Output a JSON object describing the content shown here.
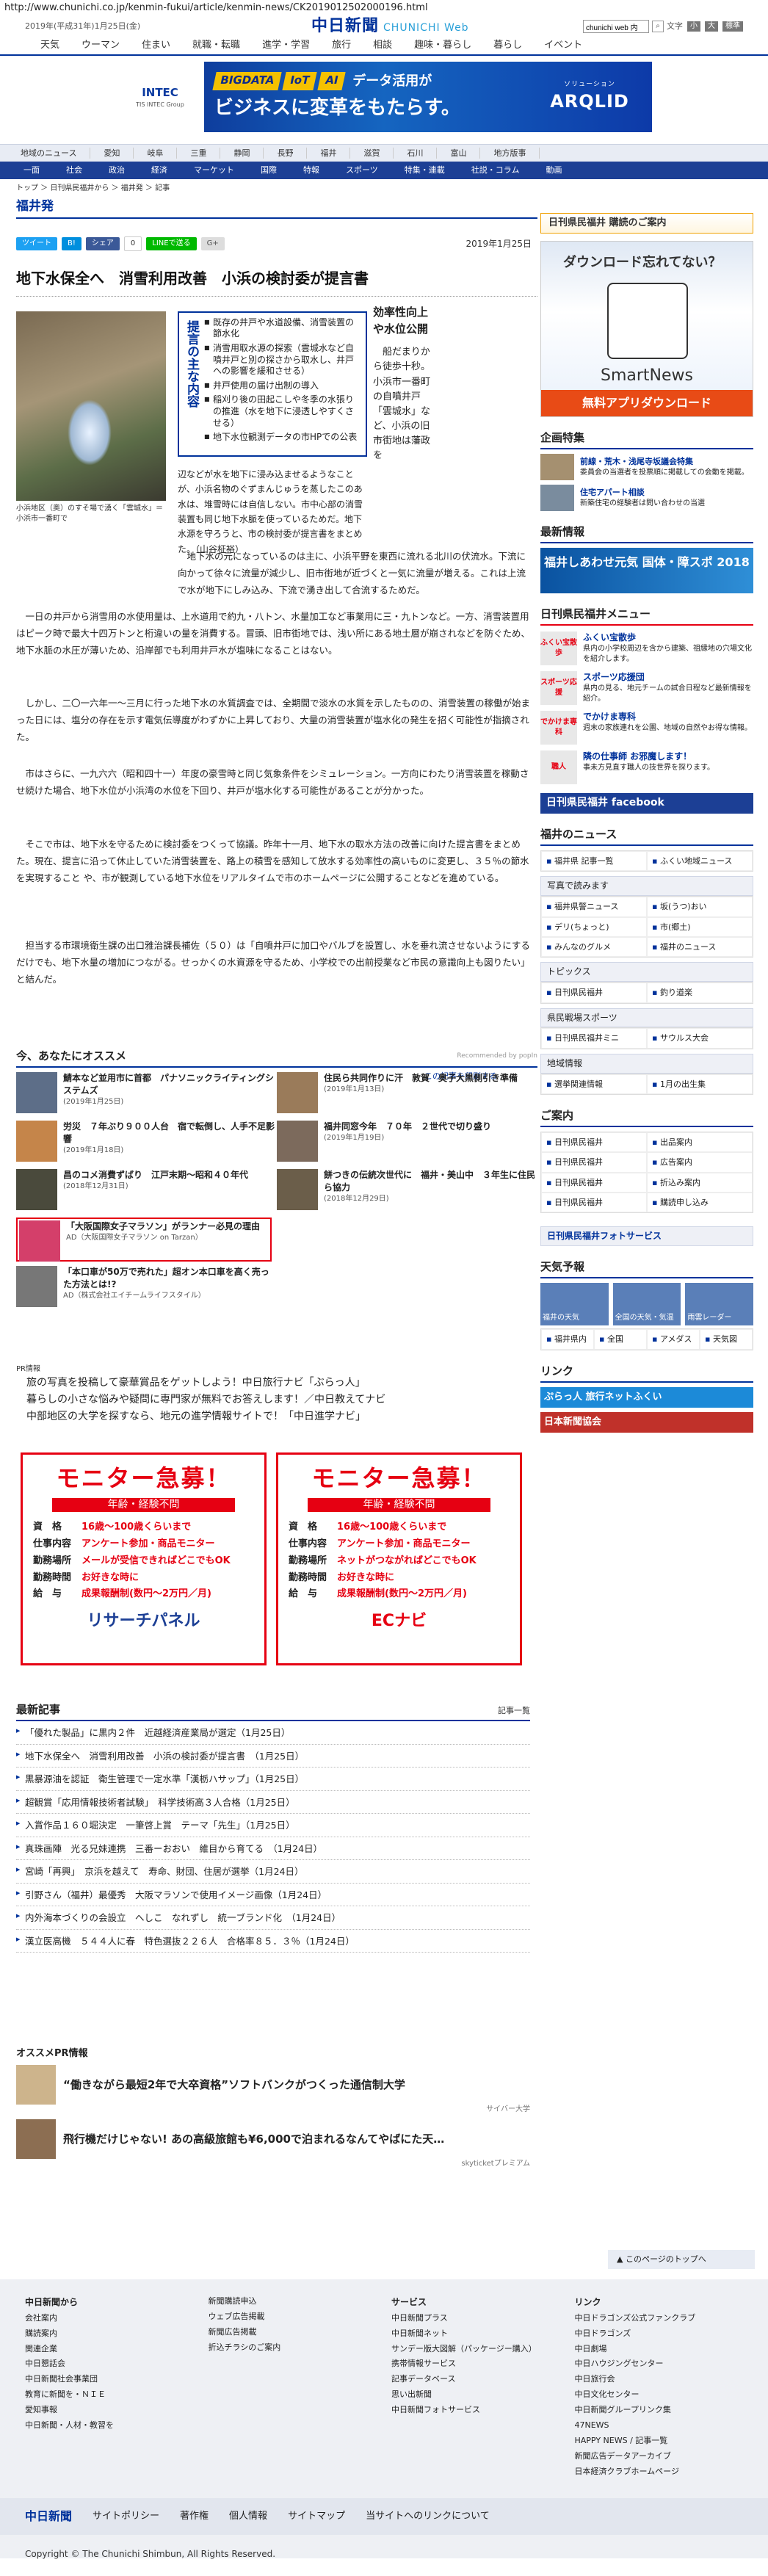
{
  "url": "http://www.chunichi.co.jp/kenmin-fukui/article/kenmin-news/CK2019012502000196.html",
  "top": {
    "date": "2019年(平成31年)1月25日(金)",
    "logo": "中日新聞",
    "logo_web": "CHUNICHI Web",
    "search_value": "chunichi web 内",
    "go": "文字",
    "font1": "小",
    "font2": "大",
    "font3": "標準"
  },
  "gnav": [
    "天気",
    "ウーマン",
    "住まい",
    "就職・転職",
    "進学・学習",
    "旅行",
    "相談",
    "趣味・暮らし",
    "暮らし",
    "イベント"
  ],
  "banner": {
    "brand": "INTEC",
    "brand_sub": "TIS INTEC Group",
    "tags": [
      "BIGDATA",
      "IoT",
      "AI"
    ],
    "tag_text": "データ活用が",
    "copy": "ビジネスに変革をもたらす。",
    "right": "ARQLID",
    "right_sub": "ソリューション"
  },
  "nav1": [
    "地域のニュース",
    "愛知",
    "岐阜",
    "三重",
    "静岡",
    "長野",
    "福井",
    "滋賀",
    "石川",
    "富山",
    "地方版事"
  ],
  "nav2": [
    "一面",
    "社会",
    "政治",
    "経済",
    "マーケット",
    "国際",
    "特報",
    "スポーツ",
    "特集・連載",
    "社説・コラム",
    "動画"
  ],
  "breadcrumb": "トップ ＞ 日刊県民福井から ＞ 福井発 ＞ 記事",
  "section": "福井発",
  "share": {
    "tweet": "ツイート",
    "hatena": "B!",
    "fb": "シェア",
    "fb_count": "0",
    "line": "LINEで送る",
    "gplus": "G+",
    "date": "2019年1月25日"
  },
  "headline": "地下水保全へ　消雪利用改善　小浜の検討委が提言書",
  "photo_caption": "小浜地区（奥）のすそ場で湧く「雲城水」＝小浜市一番町で",
  "kp": {
    "title": "提言の主な内容",
    "items": [
      "既存の井戸や水道設備、消雪装置の節水化",
      "消雪用取水源の探索（雲城水など自噴井戸と別の探さから取水し、井戸への影響を緩和させる）",
      "井戸使用の届け出制の導入",
      "稲刈り後の田起こしや冬季の水張りの推進（水を地下に浸透しやすくさせる）",
      "地下水位観測データの市HPでの公表"
    ]
  },
  "vcol": {
    "sub": "効率性向上や水位公開",
    "text": "　船だまりから徒歩十秒。小浜市一番町の自噴井戸「雲城水」など、小浜の旧市街地は藩政を"
  },
  "para_caption": "辺だけでなく地区全域を対象とした冬の小浜地区で毎年繰り返される地下水枯渇の問題を受け、市が設置した有識者らの検討委が提言書をまとめた。（山谷柾裕）",
  "kpcap": "辺などが水を地下に浸み込ませるようなことが、小浜名物のぐずまんじゅうを蒸したこのあ水は、堆雪時には自信しない。市中心部の消雪装置も同じ地下水脈を使っているためだ。地下水源を守ろうと、市の検討委が提言書をまとめた。（山谷柾裕）",
  "paras": [
    "　地下水の元になっているのは主に、小浜平野を東西に流れる北川の伏流水。下流に向かって徐々に流量が減少し、旧市街地が近づくと一気に流量が増える。これは上流で水が地下にしみ込み、下流で湧き出して合流するためだ。",
    "　一日の井戸から消雪用の水使用量は、上水道用で約九・八トン、水量加工など事業用に三・九トンなど。一方、消雪装置用はピーク時で最大十四万トンと桁違いの量を消費する。冒頭、旧市街地では、浅い所にある地土層が崩されなどを防ぐため、地下水脈の水圧が薄いため、沿岸部でも利用井戸水が塩味になることはない。",
    "　しかし、二〇一六年一〜三月に行った地下水の水質調査では、全期間で淡水の水質を示したものの、消雪装置の稼働が始まった日には、塩分の存在を示す電気伝導度がわずかに上昇しており、大量の消雪装置が塩水化の発生を招く可能性が指摘された。",
    "　市はさらに、一九六六（昭和四十一）年度の豪雪時と同じ気象条件をシミュレーション。一方向にわたり消雪装置を稼動させ続けた場合、地下水位が小浜湾の水位を下回り、井戸が塩水化する可能性があることが分かった。",
    "　そこで市は、地下水を守るために検討委をつくって協議。昨年十一月、地下水の取水方法の改善に向けた提言書をまとめた。現在、提言に沿って休止していた消雪装置を、路上の積雪を感知して放水する効率性の高いものに変更し、３５％の節水を実現すること や、市が観測している地下水位をリアルタイムで市のホームページに公開することなどを進めている。",
    "　担当する市環境衛生課の出口雅治課長補佐（５０）は「自噴井戸に加口やバルブを設置し、水を垂れ流させないようにするだけでも、地下水量の増加につながる。せっかくの水資源を守るため、小学校での出前授業など市民の意識向上も図りたい」と結んだ。"
  ],
  "reclink": "この記事を印刷する",
  "osusume": {
    "title": "今、あなたにオススメ",
    "powered": "Recommended by popIn",
    "cards": [
      {
        "t": "鯖本など並用市に首都　パナソニックライティングシステムズ",
        "d": "(2019年1月25日)"
      },
      {
        "t": "住民ら共同作りに汗　敦賀　奥子大黒側引き準備",
        "d": "(2019年1月13日)"
      },
      {
        "t": "労災　７年ぶり９００人台　宿で転倒し、人手不足影響",
        "d": "(2019年1月18日)"
      },
      {
        "t": "福井同窓今年　７０年　２世代で切り盛り",
        "d": "(2019年1月19日)"
      },
      {
        "t": "昌のコメ消費ずばり　江戸末期〜昭和４０年代",
        "d": "(2018年12月31日)"
      },
      {
        "t": "餅つきの伝統次世代に　福井・美山中　３年生に住民ら協力",
        "d": "(2018年12月29日)"
      },
      {
        "t": "「大阪国際女子マラソン」がランナー必見の理由",
        "d": "AD（大阪国際女子マラソン on Tarzan）"
      },
      {
        "t": "「本口車が50万で売れた」超オン本口車を高く売った方法とは!?",
        "d": "AD（株式会社エイチームライフスタイル）"
      }
    ]
  },
  "pr": {
    "title": "PR情報",
    "items": [
      "旅の写真を投稿して豪華賞品をゲットしよう！中日旅行ナビ「ぶらっ人」",
      "暮らしの小さな悩みや疑問に専門家が無料でお答えします！／中日教えてナビ",
      "中部地区の大学を探すなら、地元の進学情報サイトで！「中日進学ナビ」"
    ]
  },
  "monitor": [
    {
      "head": "モニター急募！",
      "band": "年齢・経験不問",
      "r1l": "資　格",
      "r1": "16歳〜100歳くらいまで",
      "r2l": "仕事内容",
      "r2": "アンケート参加・商品モニター",
      "r3l": "勤務場所",
      "r3": "メールが受信できればどこでもOK",
      "r4l": "勤務時間",
      "r4": "お好きな時に",
      "r5l": "給　与",
      "r5": "成果報酬制(数円〜2万円／月)",
      "logo": "リサーチパネル"
    },
    {
      "head": "モニター急募！",
      "band": "年齢・経験不問",
      "r1l": "資　格",
      "r1": "16歳〜100歳くらいまで",
      "r2l": "仕事内容",
      "r2": "アンケート参加・商品モニター",
      "r3l": "勤務場所",
      "r3": "ネットがつながればどこでもOK",
      "r4l": "勤務時間",
      "r4": "お好きな時に",
      "r5l": "給　与",
      "r5": "成果報酬制(数円〜2万円／月)",
      "logo": "ECナビ"
    }
  ],
  "latest": {
    "title": "最新記事",
    "more": "記事一覧",
    "items": [
      "「優れた製品」に黒内２件　近越経済産業局が選定（1月25日）",
      "地下水保全へ　消雪利用改善　小浜の検討委が提言書　（1月25日）",
      "黒暴源油を認証　衛生管理で一定水準「漢栃ハサップ」（1月25日）",
      "超観賞「応用情報技術者試験」　科学技術高３人合格（1月25日）",
      "入賞作品１６０堀決定　一筆啓上賞　テーマ「先生」（1月25日）",
      "真珠画陣　光る兄妹連携　三番ーおおい　維目から育てる　（1月24日）",
      "宮崎「再興」　京浜を越えて　寿命、財団、住居が選挙（1月24日）",
      "引野さん（福井）最優秀　大阪マラソンで使用イメージ画像（1月24日）",
      "内外海本づくりの会設立　へしこ　なれずし　統一ブランド化　（1月24日）",
      "漢立医高機　５４４人に春　特色選抜２２６人　合格率８５．３％（1月24日）"
    ]
  },
  "osupr": {
    "title": "オススメPR情報",
    "items": [
      "“働きながら最短2年で大卒資格”ソフトバンクがつくった通信制大学",
      "飛行機だけじゃない! あの高級旅館も¥6,000で泊まれるなんてやばにた天…"
    ],
    "by1": "サイバー大学",
    "by2": "skyticketプレミアム"
  },
  "side": {
    "kenmin_btn": "日刊県民福井 購読のご案内",
    "smartnews": {
      "title": "ダウンロード忘れてない？",
      "name": "SmartNews",
      "dl": "無料アプリダウンロード"
    },
    "kikaku": {
      "title": "企画特集",
      "items": [
        {
          "t": "前線・荒木・浅尾寺坂議会特集",
          "d": "委員会の当選者を投票順に掲載しての会動を掲載。"
        },
        {
          "t": "住宅アパート相談",
          "d": "新築住宅の経験者は問い合わせの当選"
        }
      ]
    },
    "saishin": "最新情報",
    "kokuta": "福井しあわせ元気 国体・障スポ 2018",
    "menu": {
      "title": "日刊県民福井メニュー",
      "items": [
        {
          "ic": "ふくい宝散歩",
          "t": "ふくい宝散歩",
          "d": "県内の小学校周辺を含から建築、祖縁地の穴場文化を紹介します。"
        },
        {
          "ic": "スポーツ応援",
          "t": "スポーツ応援団",
          "d": "県内の見る、地元チームの試合日程など最新情報を紹介。"
        },
        {
          "ic": "でかけま専科",
          "t": "でかけま専科",
          "d": "週末の家族連れを公園、地域の自然やお得な情報。"
        },
        {
          "ic": "職人",
          "t": "隣の仕事師 お邪魔します！",
          "d": "事未方見直す職人の技世界を探ります。"
        }
      ],
      "fb": "日刊県民福井 facebook"
    },
    "news": {
      "title": "福井のニュース",
      "tabs": [
        "福井県 記事一覧",
        "ふくい地域ニュース"
      ],
      "sub1": "写真で読みます",
      "items": [
        "福井県警ニュース",
        "坂(うつ)おい",
        "デリ(ちょっと)",
        "市(郷土)",
        "みんなのグルメ",
        "福井のニュース"
      ],
      "topics": "トピックス",
      "topics_items": [
        "日刊県民福井",
        "釣り道楽"
      ],
      "kenmin_sports": "県民戦場スポーツ",
      "ksp": [
        "日刊県民福井ミニ",
        "サウルス大会"
      ],
      "chiiki": "地域情報",
      "chiiki_items": [
        "選挙関連情報",
        "1月の出生集"
      ]
    },
    "annai": {
      "title": "ご案内",
      "items": [
        "日刊県民福井",
        "出品案内",
        "日刊県民福井",
        "広告案内",
        "日刊県民福井",
        "折込み案内",
        "日刊県民福井",
        "購読申し込み"
      ]
    },
    "photo": {
      "title": "日刊県民福井フォトサービス"
    },
    "weather": {
      "title": "天気予報",
      "items": [
        "福井の天気",
        "全国の天気・気温",
        "雨雲レーダー"
      ],
      "links": [
        "福井県内",
        "全国",
        "アメダス",
        "天気図"
      ]
    },
    "link": {
      "title": "リンク",
      "items": [
        "ぷらっ人 旅行ネットふくい",
        "日本新聞協会"
      ]
    }
  },
  "pagetop": "このページのトップへ",
  "footer": {
    "cols": [
      {
        "h": "中日新聞から",
        "items": [
          "会社案内",
          "購読案内",
          "関連企業",
          "中日懇話会",
          "中日新聞社会事業団",
          "教育に新聞を・ＮＩＥ",
          "愛知事報",
          "中日新聞・人材・教習を"
        ]
      },
      {
        "h": "",
        "items": [
          "新聞購読申込",
          "ウェブ広告掲載",
          "新聞広告掲載",
          "折込チラシのご案内"
        ]
      },
      {
        "h": "サービス",
        "items": [
          "中日新聞プラス",
          "中日新聞ネット",
          "サンデー版大図解（パッケージー購入）",
          "携帯情報サービス",
          "記事データベース",
          "思い出新聞",
          "中日新聞フォトサービス"
        ]
      },
      {
        "h": "リンク",
        "items": [
          "中日ドラゴンズ公式ファンクラブ",
          "中日ドラゴンズ",
          "中日劇場",
          "中日ハウジングセンター",
          "中日旅行会",
          "中日文化センター",
          "中日新聞グループリンク集",
          "47NEWS",
          "HAPPY NEWS / 記事一覧",
          "新聞広告データアーカイブ",
          "日本経済クラブホームページ"
        ]
      }
    ]
  },
  "fbar": {
    "logo": "中日新聞",
    "items": [
      "サイトポリシー",
      "著作権",
      "個人情報",
      "サイトマップ",
      "当サイトへのリンクについて"
    ]
  },
  "copyright": "Copyright © The Chunichi Shimbun, All Rights Reserved."
}
